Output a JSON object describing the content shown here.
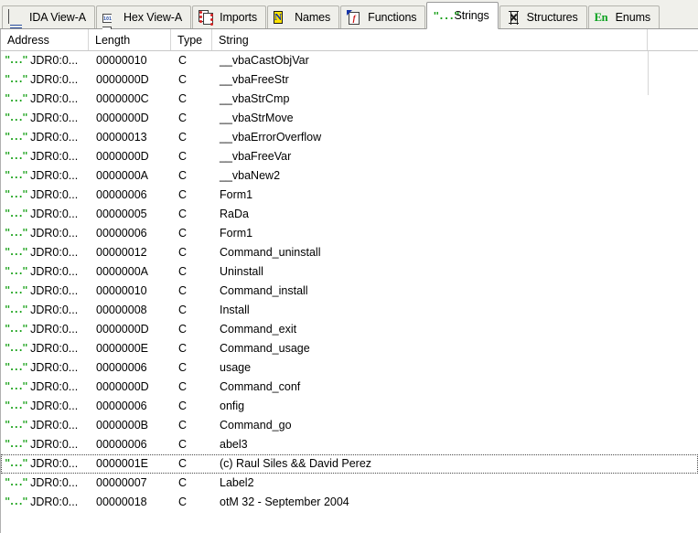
{
  "window": {
    "title": "IDA Strings Window",
    "accent_green": "#0d9a0d",
    "tab_active_bg": "#ffffff",
    "tab_inactive_bg": "#efefea"
  },
  "tabs": [
    {
      "label": "IDA View-A",
      "icon": "document-page-icon",
      "active": false
    },
    {
      "label": "Hex View-A",
      "icon": "hex-page-icon",
      "active": false
    },
    {
      "label": "Imports",
      "icon": "imports-icon",
      "active": false
    },
    {
      "label": "Names",
      "icon": "names-n-icon",
      "active": false
    },
    {
      "label": "Functions",
      "icon": "functions-f-icon",
      "active": false
    },
    {
      "label": "Strings",
      "icon": "strings-quote-icon",
      "active": true
    },
    {
      "label": "Structures",
      "icon": "structures-icon",
      "active": false
    },
    {
      "label": "Enums",
      "icon": "enums-en-icon",
      "active": false
    }
  ],
  "table": {
    "columns": [
      "Address",
      "Length",
      "Type",
      "String"
    ],
    "row_icon": "string-quote-icon",
    "rows": [
      {
        "address": "JDR0:0...",
        "length": "00000010",
        "type": "C",
        "string": "__vbaCastObjVar",
        "selected": false
      },
      {
        "address": "JDR0:0...",
        "length": "0000000D",
        "type": "C",
        "string": "__vbaFreeStr",
        "selected": false
      },
      {
        "address": "JDR0:0...",
        "length": "0000000C",
        "type": "C",
        "string": "__vbaStrCmp",
        "selected": false
      },
      {
        "address": "JDR0:0...",
        "length": "0000000D",
        "type": "C",
        "string": "__vbaStrMove",
        "selected": false
      },
      {
        "address": "JDR0:0...",
        "length": "00000013",
        "type": "C",
        "string": "__vbaErrorOverflow",
        "selected": false
      },
      {
        "address": "JDR0:0...",
        "length": "0000000D",
        "type": "C",
        "string": "__vbaFreeVar",
        "selected": false
      },
      {
        "address": "JDR0:0...",
        "length": "0000000A",
        "type": "C",
        "string": "__vbaNew2",
        "selected": false
      },
      {
        "address": "JDR0:0...",
        "length": "00000006",
        "type": "C",
        "string": "Form1",
        "selected": false
      },
      {
        "address": "JDR0:0...",
        "length": "00000005",
        "type": "C",
        "string": "RaDa",
        "selected": false
      },
      {
        "address": "JDR0:0...",
        "length": "00000006",
        "type": "C",
        "string": "Form1",
        "selected": false
      },
      {
        "address": "JDR0:0...",
        "length": "00000012",
        "type": "C",
        "string": "Command_uninstall",
        "selected": false
      },
      {
        "address": "JDR0:0...",
        "length": "0000000A",
        "type": "C",
        "string": "Uninstall",
        "selected": false
      },
      {
        "address": "JDR0:0...",
        "length": "00000010",
        "type": "C",
        "string": "Command_install",
        "selected": false
      },
      {
        "address": "JDR0:0...",
        "length": "00000008",
        "type": "C",
        "string": "Install",
        "selected": false
      },
      {
        "address": "JDR0:0...",
        "length": "0000000D",
        "type": "C",
        "string": "Command_exit",
        "selected": false
      },
      {
        "address": "JDR0:0...",
        "length": "0000000E",
        "type": "C",
        "string": "Command_usage",
        "selected": false
      },
      {
        "address": "JDR0:0...",
        "length": "00000006",
        "type": "C",
        "string": "usage",
        "selected": false
      },
      {
        "address": "JDR0:0...",
        "length": "0000000D",
        "type": "C",
        "string": "Command_conf",
        "selected": false
      },
      {
        "address": "JDR0:0...",
        "length": "00000006",
        "type": "C",
        "string": "onfig",
        "selected": false
      },
      {
        "address": "JDR0:0...",
        "length": "0000000B",
        "type": "C",
        "string": "Command_go",
        "selected": false
      },
      {
        "address": "JDR0:0...",
        "length": "00000006",
        "type": "C",
        "string": "abel3",
        "selected": false
      },
      {
        "address": "JDR0:0...",
        "length": "0000001E",
        "type": "C",
        "string": "(c) Raul Siles && David Perez",
        "selected": true
      },
      {
        "address": "JDR0:0...",
        "length": "00000007",
        "type": "C",
        "string": "Label2",
        "selected": false
      },
      {
        "address": "JDR0:0...",
        "length": "00000018",
        "type": "C",
        "string": "otM 32 - September 2004",
        "selected": false
      }
    ]
  }
}
